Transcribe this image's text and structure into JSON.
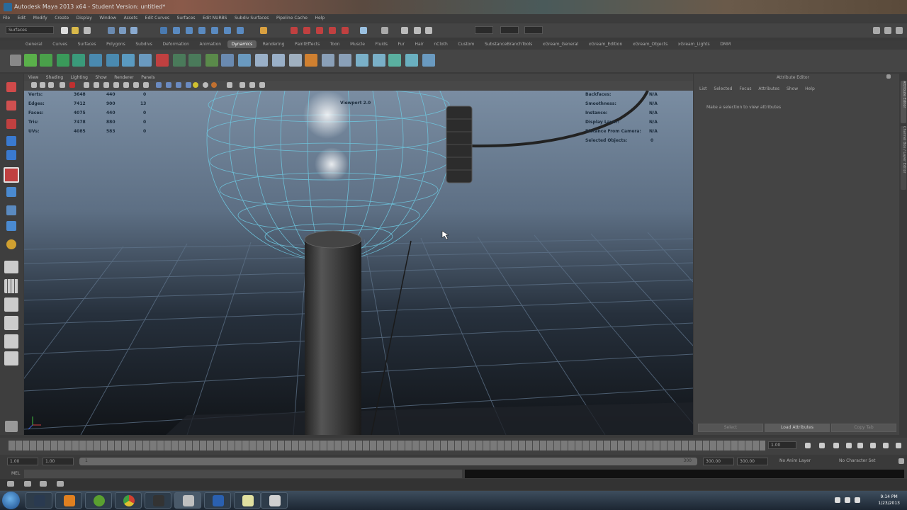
{
  "window": {
    "title": "Autodesk Maya 2013 x64 - Student Version: untitled*"
  },
  "menubar": [
    "File",
    "Edit",
    "Modify",
    "Create",
    "Display",
    "Window",
    "Assets",
    "Edit Curves",
    "Surfaces",
    "Edit NURBS",
    "Subdiv Surfaces",
    "Pipeline Cache",
    "Help"
  ],
  "mode_menu": "Surfaces",
  "shelf_tabs": [
    "General",
    "Curves",
    "Surfaces",
    "Polygons",
    "Subdivs",
    "Deformation",
    "Animation",
    "Dynamics",
    "Rendering",
    "PaintEffects",
    "Toon",
    "Muscle",
    "Fluids",
    "Fur",
    "Hair",
    "nCloth",
    "Custom",
    "SubstanceBranchTools",
    "xGream_General",
    "xGream_Edition",
    "xGream_Objects",
    "xGream_Lights",
    "DMM"
  ],
  "active_shelf_tab": "Dynamics",
  "panel_menu": [
    "View",
    "Shading",
    "Lighting",
    "Show",
    "Renderer",
    "Panels"
  ],
  "viewport": {
    "label": "Viewport 2.0",
    "hud_left": [
      {
        "label": "Verts:",
        "a": "3648",
        "b": "440",
        "c": "0"
      },
      {
        "label": "Edges:",
        "a": "7412",
        "b": "900",
        "c": "13"
      },
      {
        "label": "Faces:",
        "a": "4075",
        "b": "440",
        "c": "0"
      },
      {
        "label": "Tris:",
        "a": "7478",
        "b": "880",
        "c": "0"
      },
      {
        "label": "UVs:",
        "a": "4085",
        "b": "583",
        "c": "0"
      }
    ],
    "hud_right": [
      {
        "label": "Backfaces:",
        "value": "N/A"
      },
      {
        "label": "Smoothness:",
        "value": "N/A"
      },
      {
        "label": "Instance:",
        "value": "N/A"
      },
      {
        "label": "Display Layer:",
        "value": "N/A"
      },
      {
        "label": "Distance From Camera:",
        "value": "N/A"
      },
      {
        "label": "Selected Objects:",
        "value": "0"
      }
    ]
  },
  "attribute_editor": {
    "title": "Attribute Editor",
    "menu": [
      "List",
      "Selected",
      "Focus",
      "Attributes",
      "Show",
      "Help"
    ],
    "message": "Make a selection to view attributes",
    "buttons": [
      "Select",
      "Load Attributes",
      "Copy Tab"
    ]
  },
  "side_tabs": [
    "Attribute Editor",
    "Channel Box / Layer Editor"
  ],
  "time_slider": {
    "current": "1.00"
  },
  "range": {
    "start": "1.00",
    "inner_start": "1.00",
    "range_start": "1",
    "range_end": "300",
    "inner_end": "300.00",
    "end": "300.00",
    "anim_layer": "No Anim Layer",
    "char_set": "No Character Set"
  },
  "command_line": {
    "label": "MEL"
  },
  "taskbar": {
    "time": "9:14 PM",
    "date": "1/23/2013"
  }
}
